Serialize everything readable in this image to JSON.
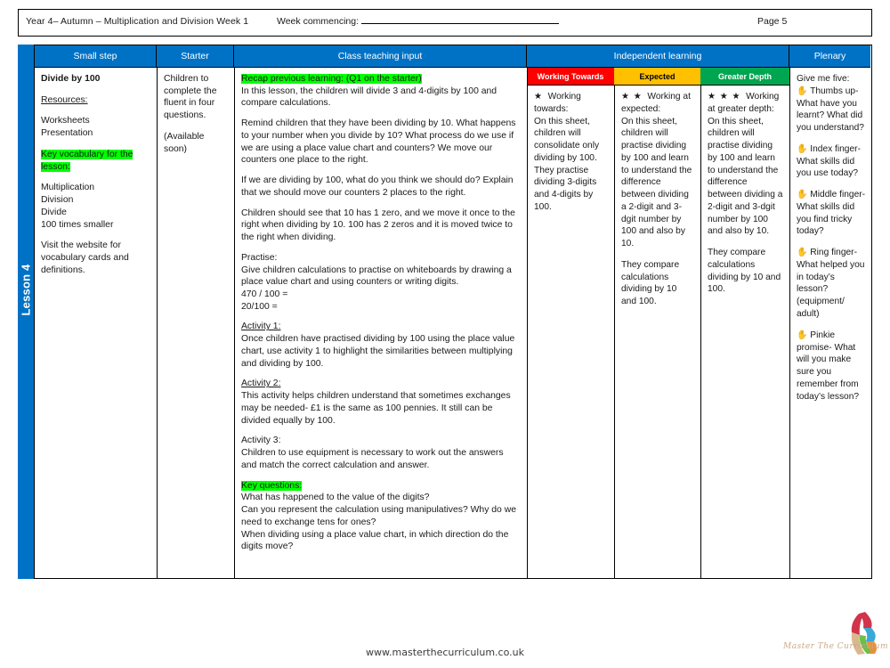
{
  "header": {
    "title": "Year 4– Autumn – Multiplication and Division Week 1",
    "week_commencing_label": "Week commencing:",
    "page_label": "Page 5"
  },
  "spine": {
    "lesson_label": "Lesson 4",
    "color": "#0072c6"
  },
  "columns": [
    {
      "key": "small_step",
      "label": "Small step"
    },
    {
      "key": "starter",
      "label": "Starter"
    },
    {
      "key": "class_teaching_input",
      "label": "Class teaching input"
    },
    {
      "key": "independent_learning",
      "label": "Independent learning"
    },
    {
      "key": "plenary",
      "label": "Plenary"
    }
  ],
  "ability_headers": [
    {
      "key": "working_towards",
      "label": "Working Towards",
      "color": "#ff0000"
    },
    {
      "key": "expected",
      "label": "Expected",
      "color": "#ffc000"
    },
    {
      "key": "greater_depth",
      "label": "Greater Depth",
      "color": "#00a550"
    }
  ],
  "small_step": {
    "title": "Divide by 100",
    "resources_label": "Resources:",
    "resources": "Worksheets\nPresentation",
    "key_vocab_label": "Key vocabulary for the lesson:",
    "vocabulary": "Multiplication\nDivision\nDivide\n100 times smaller",
    "website_note": "Visit the website for vocabulary cards and definitions."
  },
  "starter": {
    "body": "Children to complete the fluent in four questions.",
    "availability": "(Available soon)"
  },
  "class_teaching_input": {
    "recap_label": "Recap previous learning: (Q1 on the starter)",
    "recap_body": "In this lesson, the children will divide 3 and 4-digits by 100 and compare calculations.",
    "para_remind": "Remind children that they have been dividing by 10. What happens to your number when you divide by 10? What process do we use if we are using a place value chart and counters? We move our counters one place to the right.",
    "para_dividing_100": "If we are dividing by 100, what do you think we should do? Explain that we should move our counters 2 places to the right.",
    "para_zeros": "Children should see that 10 has 1 zero, and we move it once to the right when dividing by 10. 100 has 2 zeros and it is moved twice to the right when dividing.",
    "practise_label": "Practise:",
    "practise_body": "Give children calculations to practise on whiteboards by drawing a place value chart and using counters or writing digits.",
    "calc_1": "470 / 100 =",
    "calc_2": "20/100 =",
    "activity_1_label": "Activity 1:",
    "activity_1_body": "Once children have practised dividing by 100 using the place value chart, use activity 1 to highlight the similarities between multiplying and dividing by 100.",
    "activity_2_label": "Activity 2:",
    "activity_2_body": "This activity helps children understand that sometimes exchanges may be needed- £1 is the same as 100 pennies. It still can be divided equally by 100.",
    "activity_3_label": "Activity 3:",
    "activity_3_body": "Children to use equipment is necessary to work out the answers and match the correct calculation and answer.",
    "key_questions_label": "Key questions:",
    "key_questions": "What has happened to the value of the digits?\nCan you represent the calculation using manipulatives? Why do we need to exchange tens for ones?\nWhen dividing using a place value chart, in which direction do the digits move?"
  },
  "independent_learning": {
    "working_towards": {
      "stars": "★",
      "heading": "Working towards:",
      "body": "On this sheet, children will consolidate only dividing by 100. They practise dividing 3-digits and 4-digits by 100."
    },
    "expected": {
      "stars": "★ ★",
      "heading": "Working at expected:",
      "body": "On this sheet, children will practise dividing by 100 and learn to understand the difference between dividing a 2-digit and 3-dgit number by 100 and also by 10.",
      "body2": "They compare calculations dividing by 10 and 100."
    },
    "greater_depth": {
      "stars": "★ ★ ★",
      "heading": "Working at greater depth:",
      "body": "On this sheet, children will practise dividing by 100 and learn to understand the difference between dividing a 2-digit and 3-dgit number by 100 and also by 10.",
      "body2": "They compare calculations dividing by 10 and 100."
    }
  },
  "plenary": {
    "intro": "Give me five:",
    "hand_icon": "✋",
    "items": [
      "Thumbs up- What have you learnt? What did you understand?",
      "Index finger- What skills did you use today?",
      "Middle finger- What skills did you find tricky today?",
      "Ring finger- What helped you in today’s lesson? (equipment/ adult)",
      "Pinkie promise- What will you make sure you remember from today’s lesson?"
    ]
  },
  "footer": {
    "url": "www.masterthecurriculum.co.uk",
    "logo_text": "Master The Curriculum"
  }
}
